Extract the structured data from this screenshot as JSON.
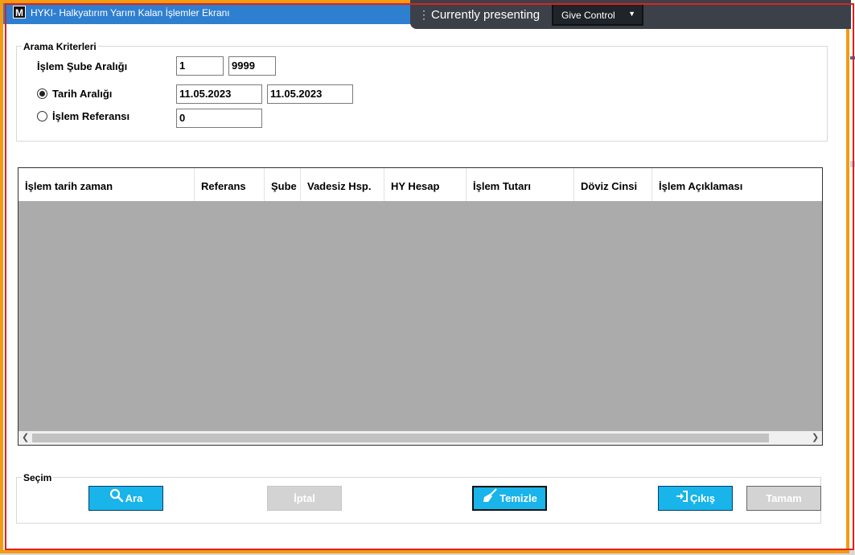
{
  "window": {
    "title": "HYKI- Halkyatırım Yarım Kalan İşlemler Ekranı",
    "icon_letter": "M"
  },
  "presenting": {
    "status": "Currently presenting",
    "give_control_label": "Give Control"
  },
  "search": {
    "legend": "Arama Kriterleri",
    "branch_range_label": "İşlem Şube Aralığı",
    "branch_from": "1",
    "branch_to": "9999",
    "date_range_label": "Tarih Aralığı",
    "date_from": "11.05.2023",
    "date_to": "11.05.2023",
    "reference_label": "İşlem Referansı",
    "reference_value": "0",
    "selected_option": "Tarih Aralığı"
  },
  "grid": {
    "columns": [
      "İşlem tarih zaman",
      "Referans",
      "Şube",
      "Vadesiz Hsp.",
      "HY Hesap",
      "İşlem Tutarı",
      "Döviz Cinsi",
      "İşlem Açıklaması"
    ],
    "rows": []
  },
  "selection": {
    "legend": "Seçim",
    "buttons": {
      "search": "Ara",
      "cancel": "İptal",
      "clear": "Temizle",
      "exit": "Çıkış",
      "ok": "Tamam"
    }
  },
  "colors": {
    "titlebar": "#2f7fd0",
    "button_blue": "#18b4ea",
    "button_disabled": "#d3d3d3",
    "grid_empty": "#ababab",
    "window_outline": "#f39c12",
    "share_outline": "#e02020"
  }
}
